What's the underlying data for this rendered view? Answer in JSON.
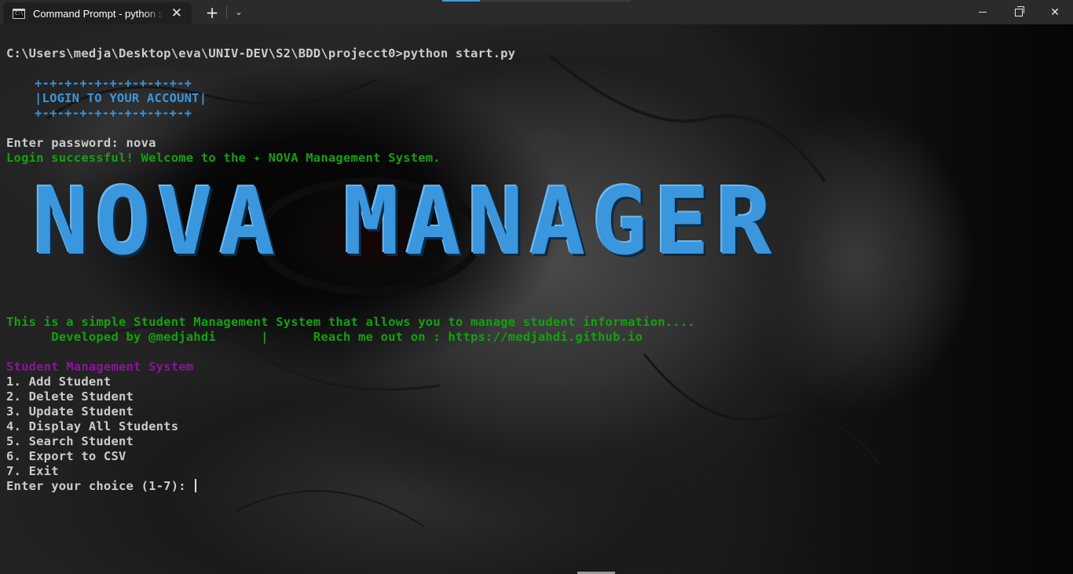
{
  "window": {
    "tab_title": "Command Prompt - python start.py",
    "tab_icon_glyph": "C:\\",
    "close_tab": "✕",
    "new_tab": "+",
    "dropdown": "⌄",
    "minimize": "",
    "maximize": "",
    "close": "✕"
  },
  "terminal": {
    "command_line": "C:\\Users\\medja\\Desktop\\eva\\UNIV-DEV\\S2\\BDD\\projecct0>python start.py",
    "login_box_top": "+-+-+-+-+-+-+-+-+-+-+",
    "login_box_text": "|LOGIN TO YOUR ACCOUNT|",
    "login_box_bottom": "+-+-+-+-+-+-+-+-+-+-+",
    "password_prompt": "Enter password: nova",
    "login_success": "Login successful! Welcome to the ✦ NOVA Management System.",
    "banner": "NOVA MANAGER",
    "description": "This is a simple Student Management System that allows you to manage student information....",
    "credits": "      Developed by @medjahdi      |      Reach me out on : https://medjahdi.github.io",
    "menu_title": "Student Management System",
    "menu_items": [
      "1. Add Student",
      "2. Delete Student",
      "3. Update Student",
      "4. Display All Students",
      "5. Search Student",
      "6. Export to CSV",
      "7. Exit"
    ],
    "choice_prompt": "Enter your choice (1-7): "
  },
  "colors": {
    "green": "#13a10e",
    "blue": "#3a96dd",
    "purple": "#881798",
    "text": "#cccccc"
  }
}
